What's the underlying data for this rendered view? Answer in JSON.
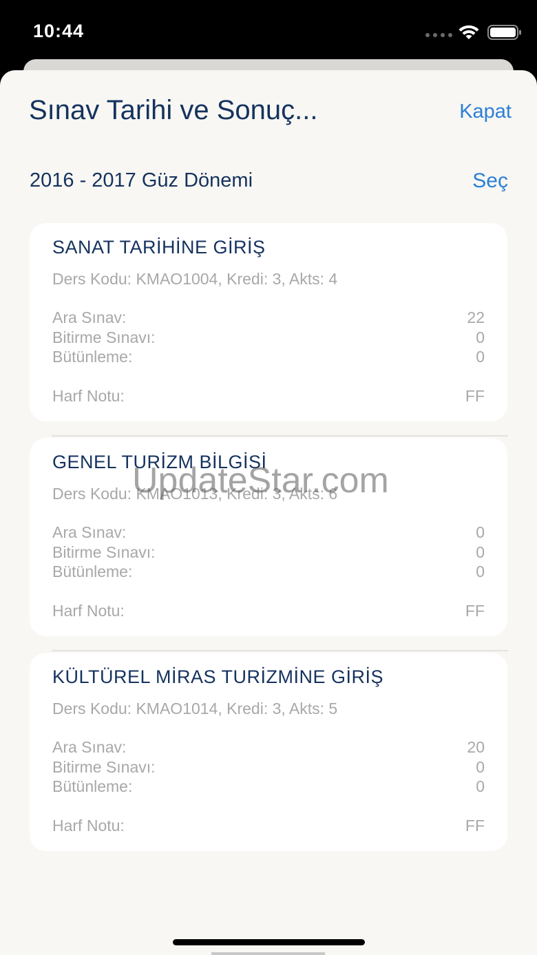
{
  "status_bar": {
    "time": "10:44",
    "wifi_icon": "wifi-icon",
    "battery_icon": "battery-icon"
  },
  "header": {
    "title": "Sınav Tarihi ve Sonuç...",
    "close_label": "Kapat"
  },
  "term": {
    "label": "2016 - 2017 Güz Dönemi",
    "select_label": "Seç"
  },
  "courses": [
    {
      "name": "SANAT TARİHİNE GİRİŞ",
      "info": "Ders Kodu: KMAO1004, Kredi: 3, Akts: 4",
      "grades": [
        {
          "label": "Ara Sınav:",
          "value": "22"
        },
        {
          "label": "Bitirme Sınavı:",
          "value": "0"
        },
        {
          "label": "Bütünleme:",
          "value": "0"
        }
      ],
      "letter_label": "Harf Notu:",
      "letter_value": "FF"
    },
    {
      "name": "GENEL TURİZM BİLGİSİ",
      "info": "Ders Kodu: KMAO1013, Kredi: 3, Akts: 6",
      "grades": [
        {
          "label": "Ara Sınav:",
          "value": "0"
        },
        {
          "label": "Bitirme Sınavı:",
          "value": "0"
        },
        {
          "label": "Bütünleme:",
          "value": "0"
        }
      ],
      "letter_label": "Harf Notu:",
      "letter_value": "FF"
    },
    {
      "name": "KÜLTÜREL MİRAS TURİZMİNE GİRİŞ",
      "info": "Ders Kodu: KMAO1014, Kredi: 3, Akts: 5",
      "grades": [
        {
          "label": "Ara Sınav:",
          "value": "20"
        },
        {
          "label": "Bitirme Sınavı:",
          "value": "0"
        },
        {
          "label": "Bütünleme:",
          "value": "0"
        }
      ],
      "letter_label": "Harf Notu:",
      "letter_value": "FF"
    }
  ],
  "watermark": "UpdateStar.com",
  "colors": {
    "title": "#15325e",
    "accent": "#2b7fd7",
    "muted_text": "#a8a8a8",
    "sheet_background": "#f8f7f3",
    "card_background": "#ffffff"
  }
}
